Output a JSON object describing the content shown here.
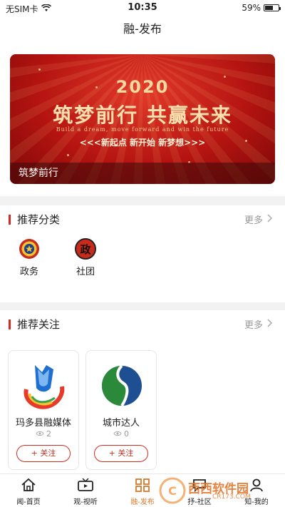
{
  "status": {
    "carrier": "无SIM卡",
    "time": "10:35",
    "battery": "59%",
    "battery_level": 0.59
  },
  "nav": {
    "title": "融-发布"
  },
  "banner": {
    "year": "2020",
    "headline": "筑梦前行 共赢未来",
    "subline_en": "Build a dream, move forward and win the future",
    "slogan": "<<<新起点 新开始 新梦想>>>",
    "caption": "筑梦前行"
  },
  "recommend_category": {
    "title": "推荐分类",
    "more": "更多",
    "items": [
      {
        "label": "政务",
        "icon": "police-emblem-icon"
      },
      {
        "label": "社团",
        "icon": "zheng-badge-icon",
        "badge_text": "政"
      }
    ]
  },
  "recommend_follow": {
    "title": "推荐关注",
    "more": "更多",
    "items": [
      {
        "name": "玛多县融媒体",
        "views": "2",
        "button": "+ 关注"
      },
      {
        "name": "城市达人",
        "views": "0",
        "button": "+ 关注"
      }
    ]
  },
  "tabs": [
    {
      "label": "闻-首页",
      "icon": "home-icon"
    },
    {
      "label": "观-视听",
      "icon": "video-icon"
    },
    {
      "label": "融-发布",
      "icon": "publish-icon",
      "active": true
    },
    {
      "label": "抒-社区",
      "icon": "community-icon"
    },
    {
      "label": "知-我的",
      "icon": "profile-icon"
    }
  ],
  "watermark": {
    "brand": "西西软件园",
    "url": "CR173.COM"
  },
  "colors": {
    "accent_red": "#d52b1e",
    "tab_active": "#d5792b",
    "banner_red": "#b51411"
  }
}
